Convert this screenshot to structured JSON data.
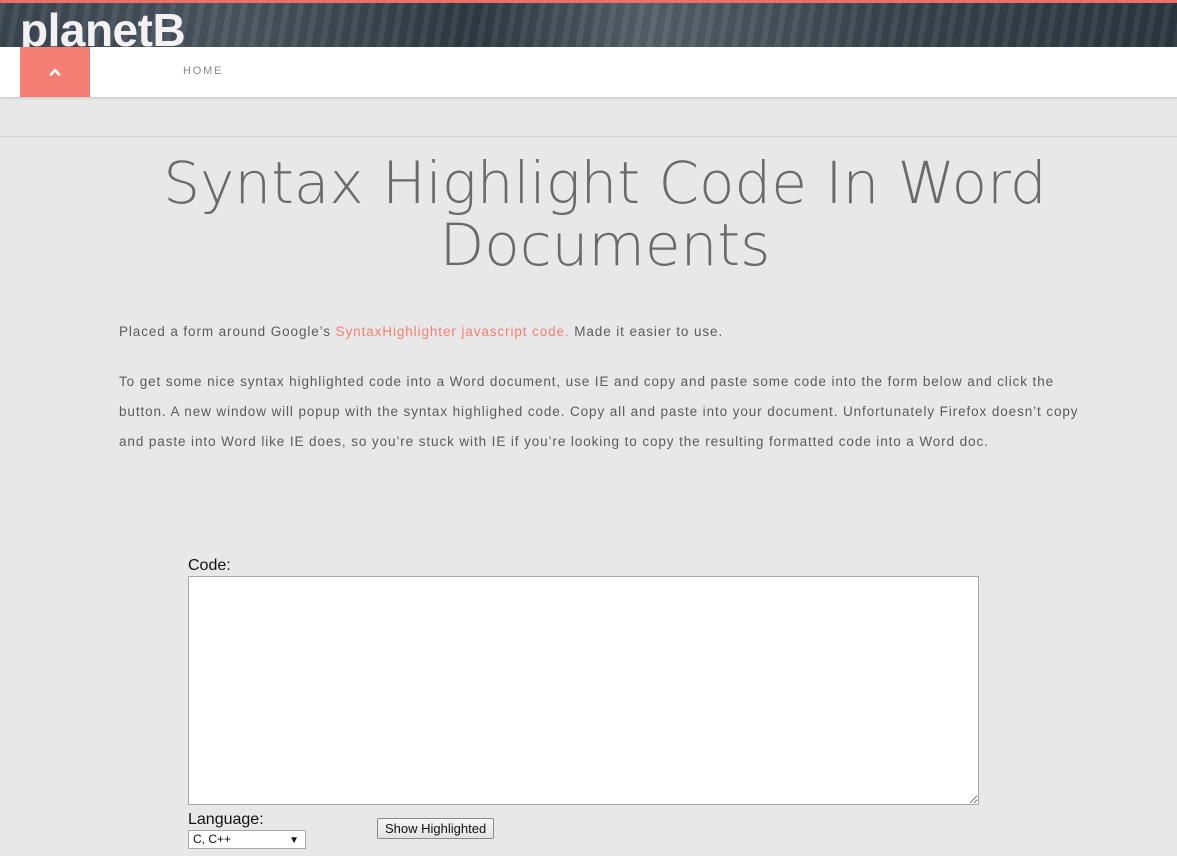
{
  "header": {
    "site_title": "planetB"
  },
  "nav": {
    "home_label": "HOME"
  },
  "page": {
    "title": "Syntax Highlight Code In Word Documents",
    "intro_before_link": "Placed a form around Google’s ",
    "intro_link": "SyntaxHighlighter javascript code.",
    "intro_after_link": " Made it easier to use.",
    "instructions": "To get some nice syntax highlighted code into a Word document, use IE and copy and paste some code into the form below and click the button. A new window will popup with the syntax highlighed code. Copy all and paste into your document. Unfortunately Firefox doesn’t copy and paste into Word like IE does, so you’re stuck with IE if you’re looking to copy the resulting formatted code into a Word doc."
  },
  "form": {
    "code_label": "Code:",
    "code_value": "",
    "language_label": "Language:",
    "language_selected": "C, C++",
    "submit_label": "Show Highlighted"
  },
  "icons": {
    "nav_toggle": "chevron-up-icon",
    "select_caret": "triangle-down-icon"
  },
  "colors": {
    "accent": "#f47e73",
    "background": "#e8e8e8",
    "title_text": "#6a6a6a",
    "body_text": "#5b5b5b"
  }
}
